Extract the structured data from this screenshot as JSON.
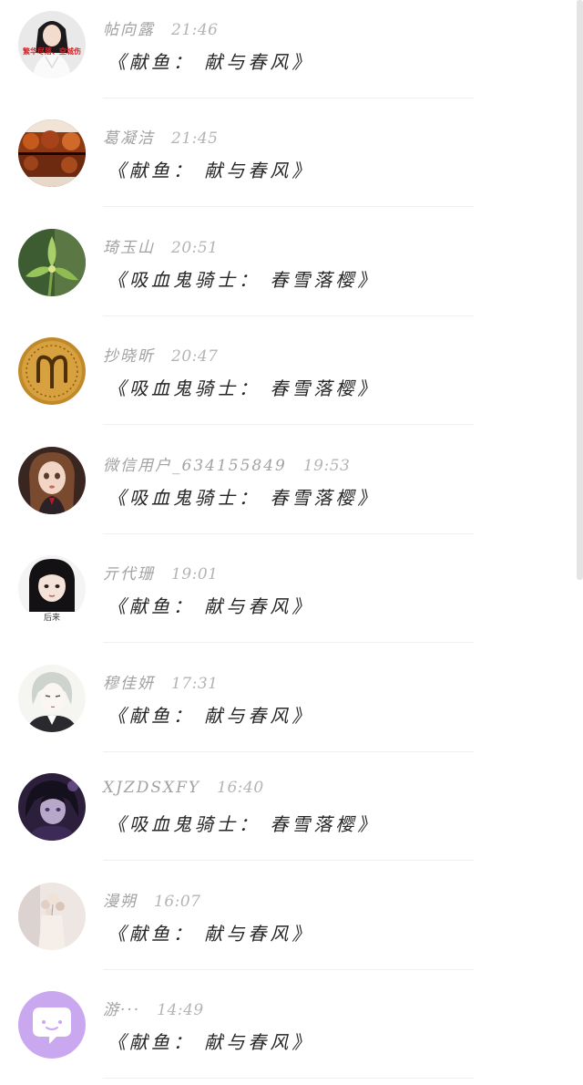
{
  "conversations": [
    {
      "name": "帖向露",
      "time": "21:46",
      "message": "《献鱼： 献与春风》",
      "avatar_text": "繁华尽落、空城伤",
      "avatar_icon": "woman-portrait-avatar"
    },
    {
      "name": "葛凝洁",
      "time": "21:45",
      "message": "《献鱼： 献与春风》",
      "avatar_icon": "autumn-lake-avatar"
    },
    {
      "name": "琦玉山",
      "time": "20:51",
      "message": "《吸血鬼骑士： 春雪落樱》",
      "avatar_icon": "green-flower-avatar"
    },
    {
      "name": "抄晓昕",
      "time": "20:47",
      "message": "《吸血鬼骑士： 春雪落樱》",
      "avatar_icon": "aries-coin-avatar"
    },
    {
      "name": "微信用户_634155849",
      "time": "19:53",
      "message": "《吸血鬼骑士： 春雪落樱》",
      "avatar_icon": "doll-avatar"
    },
    {
      "name": "亓代珊",
      "time": "19:01",
      "message": "《献鱼： 献与春风》",
      "avatar_text": "后来",
      "avatar_icon": "girl-bangs-avatar"
    },
    {
      "name": "穆佳妍",
      "time": "17:31",
      "message": "《献鱼： 献与春风》",
      "avatar_icon": "anime-boy-avatar"
    },
    {
      "name": "XJZDSXFY",
      "time": "16:40",
      "message": "《吸血鬼骑士： 春雪落樱》",
      "avatar_icon": "dark-anime-avatar"
    },
    {
      "name": "漫朔",
      "time": "16:07",
      "message": "《献鱼： 献与春风》",
      "avatar_icon": "flower-vase-avatar"
    },
    {
      "name": "游···",
      "time": "14:49",
      "message": "《献鱼： 献与春风》",
      "avatar_icon": "chat-bubble-avatar"
    }
  ]
}
